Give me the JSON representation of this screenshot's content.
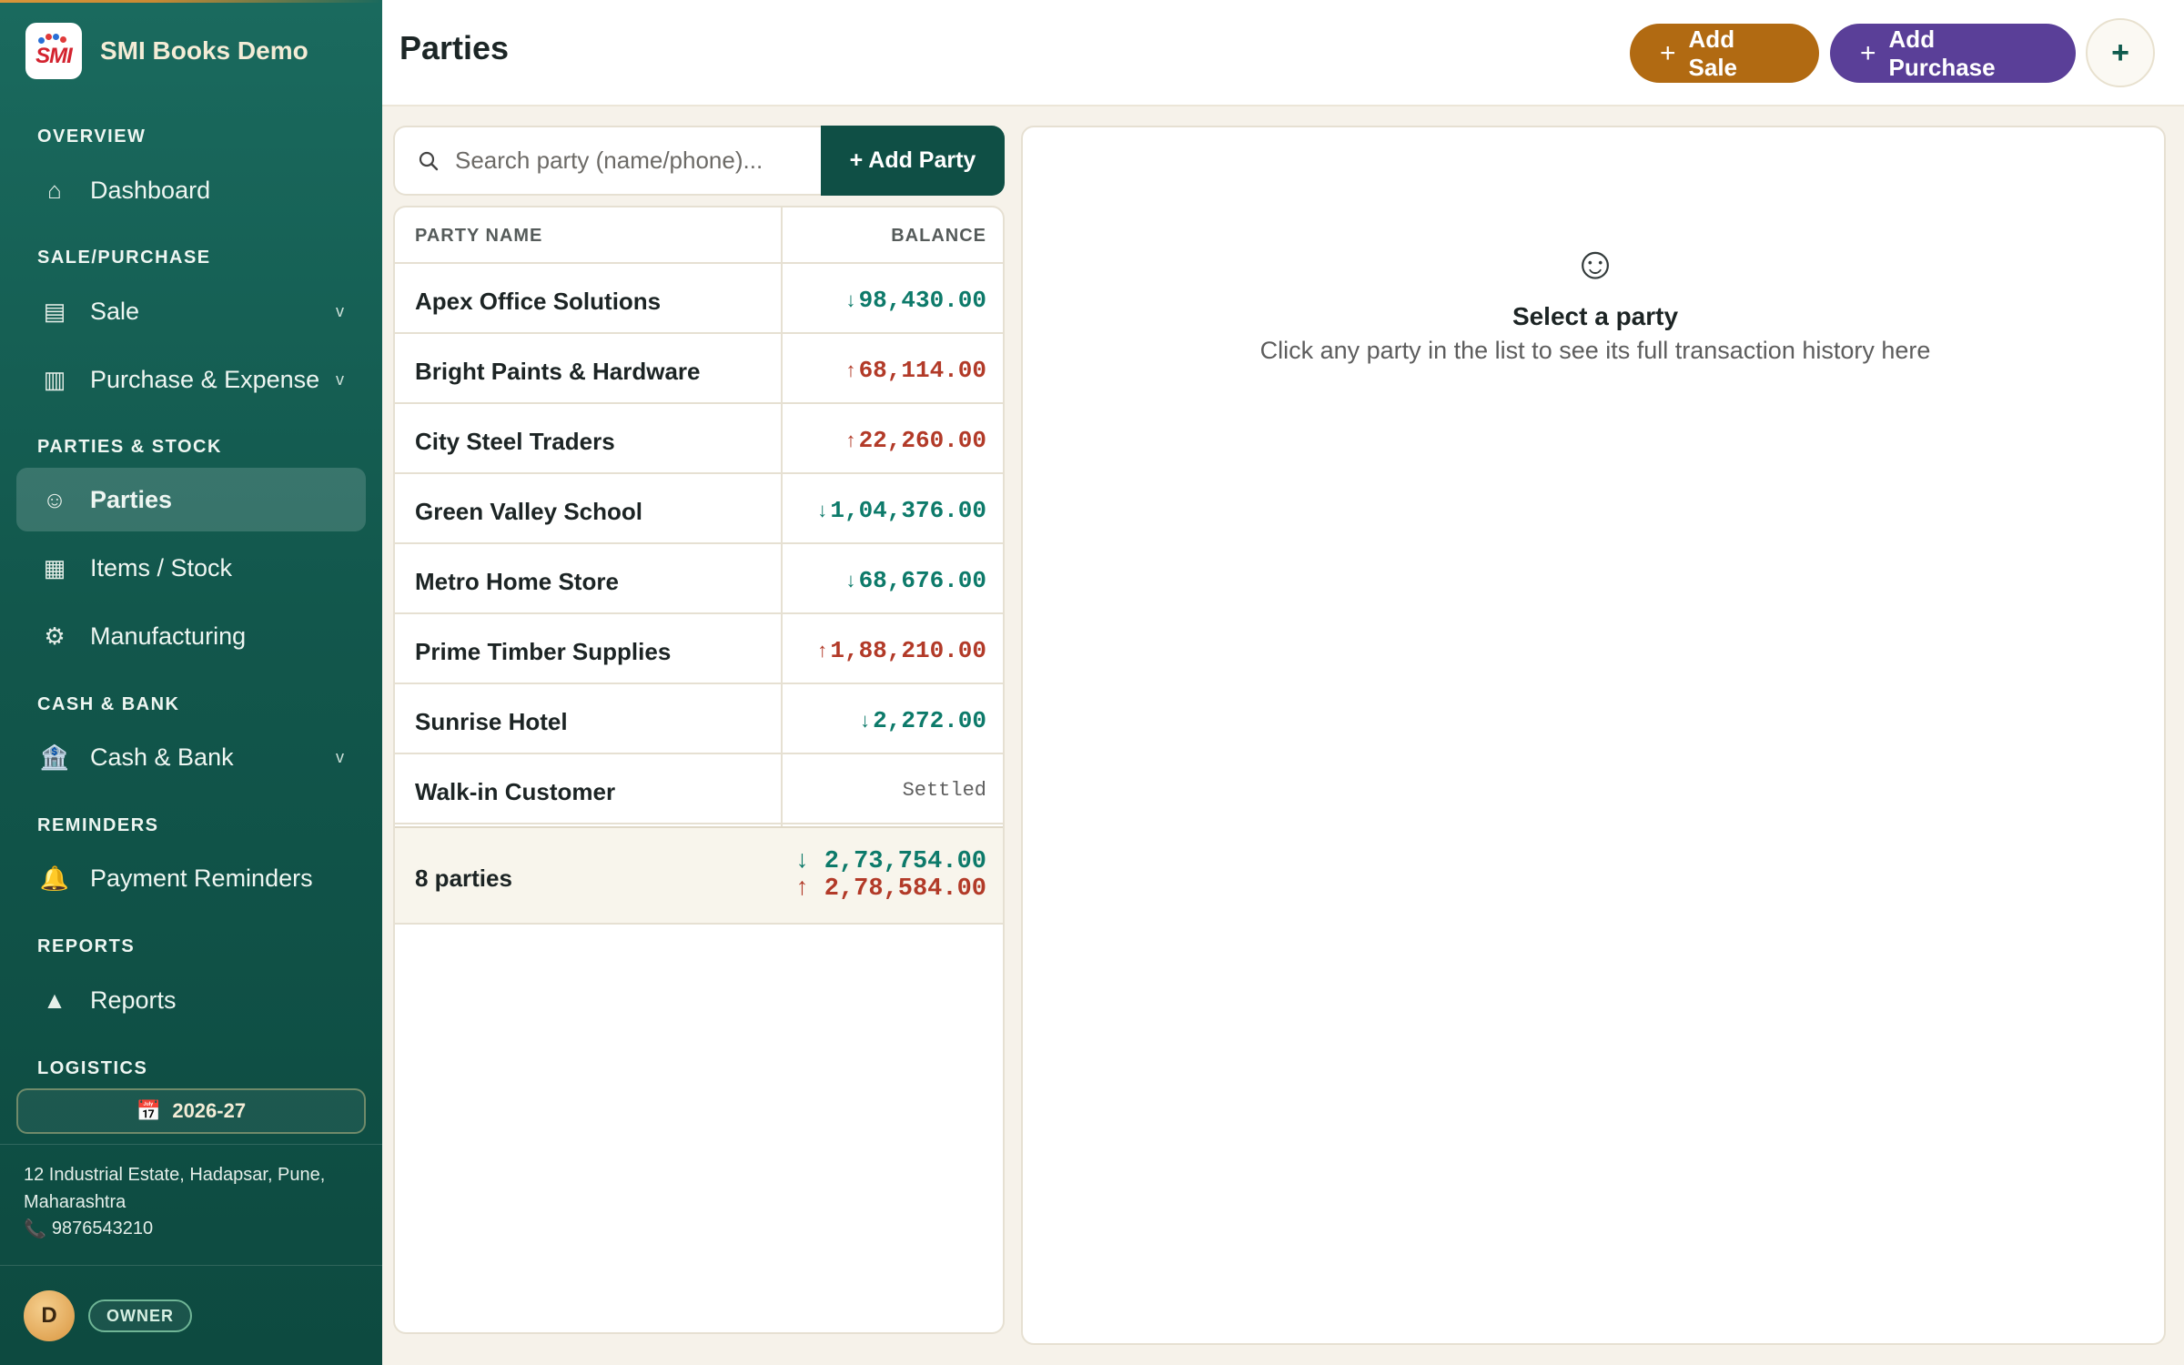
{
  "app": {
    "title": "SMI Books Demo",
    "logo_text": "SMI"
  },
  "colors": {
    "sidebar": "#12574c",
    "accent_sale": "#b16a12",
    "accent_purchase": "#5a3f98",
    "receivable": "#0d7a6a",
    "payable": "#b23a28"
  },
  "sidebar": {
    "sections": {
      "overview": "OVERVIEW",
      "sale_purchase": "SALE/PURCHASE",
      "parties_stock": "PARTIES & STOCK",
      "cash_bank": "CASH & BANK",
      "reminders": "REMINDERS",
      "reports": "REPORTS",
      "logistics": "LOGISTICS"
    },
    "items": {
      "dashboard": {
        "label": "Dashboard",
        "icon": "home-icon",
        "glyph": "⌂"
      },
      "sale": {
        "label": "Sale",
        "icon": "receipt-icon",
        "glyph": "▤",
        "chevron": "v"
      },
      "purchase": {
        "label": "Purchase & Expense",
        "icon": "cart-icon",
        "glyph": "▥",
        "chevron": "v"
      },
      "parties": {
        "label": "Parties",
        "icon": "smiley-icon",
        "glyph": "☺"
      },
      "items_stock": {
        "label": "Items / Stock",
        "icon": "grid-icon",
        "glyph": "▦"
      },
      "manufacturing": {
        "label": "Manufacturing",
        "icon": "gear-icon",
        "glyph": "⚙"
      },
      "cash_bank": {
        "label": "Cash & Bank",
        "icon": "bank-icon",
        "glyph": "🏦",
        "chevron": "v"
      },
      "payment_reminders": {
        "label": "Payment Reminders",
        "icon": "bell-icon",
        "glyph": "🔔"
      },
      "reports": {
        "label": "Reports",
        "icon": "chart-icon",
        "glyph": "▲"
      }
    },
    "financial_year": "2026-27",
    "calendar_glyph": "📅",
    "address": "12 Industrial Estate, Hadapsar, Pune, Maharashtra",
    "phone": "9876543210",
    "phone_glyph": "📞",
    "user_initial": "D",
    "role": "OWNER"
  },
  "header": {
    "title": "Parties",
    "add_sale": "Add Sale",
    "add_purchase": "Add Purchase",
    "plus": "+",
    "more": "+"
  },
  "parties": {
    "search_placeholder": "Search party (name/phone)...",
    "add_party": "+ Add Party",
    "columns": {
      "name": "PARTY NAME",
      "balance": "BALANCE"
    },
    "rows": [
      {
        "name": "Apex Office Solutions",
        "arrow": "↓",
        "balance": "98,430.00",
        "type": "rec"
      },
      {
        "name": "Bright Paints & Hardware",
        "arrow": "↑",
        "balance": "68,114.00",
        "type": "pay"
      },
      {
        "name": "City Steel Traders",
        "arrow": "↑",
        "balance": "22,260.00",
        "type": "pay"
      },
      {
        "name": "Green Valley School",
        "arrow": "↓",
        "balance": "1,04,376.00",
        "type": "rec"
      },
      {
        "name": "Metro Home Store",
        "arrow": "↓",
        "balance": "68,676.00",
        "type": "rec"
      },
      {
        "name": "Prime Timber Supplies",
        "arrow": "↑",
        "balance": "1,88,210.00",
        "type": "pay"
      },
      {
        "name": "Sunrise Hotel",
        "arrow": "↓",
        "balance": "2,272.00",
        "type": "rec"
      },
      {
        "name": "Walk-in Customer",
        "arrow": "",
        "balance": "Settled",
        "type": "settled"
      }
    ],
    "summary": {
      "count": "8 parties",
      "total_receivable": "↓ 2,73,754.00",
      "total_payable": "↑ 2,78,584.00"
    }
  },
  "detail": {
    "empty_icon": "☺",
    "empty_title": "Select a party",
    "empty_subtitle": "Click any party in the list to see its full transaction history here"
  }
}
